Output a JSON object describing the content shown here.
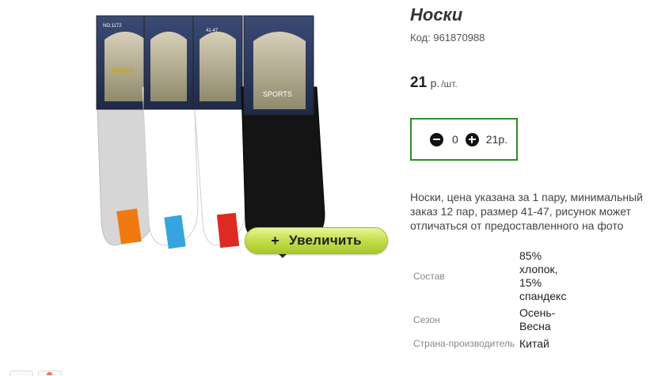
{
  "product": {
    "title": "Носки",
    "code_label": "Код:",
    "code_value": "961870988",
    "price_value": "21",
    "price_unit_main": "р.",
    "price_unit_sub": "/шт.",
    "quantity": "0",
    "total": "21р.",
    "description": "Носки, цена указана за 1 пару, минимальный заказ 12 пар, размер 41-47, рисунок может отличаться от предоставленного на фото",
    "zoom_label": "Увеличить",
    "zoom_plus": "+"
  },
  "image": {
    "package_labels": [
      "NO.1172",
      "41-47",
      "SPORTS",
      "AMISS"
    ],
    "sock_colors": [
      "#d6d6d6",
      "#ffffff",
      "#ffffff",
      "#141414"
    ],
    "heel_colors": [
      "#f07a10",
      "#36a5de",
      "#de2a22",
      "#141414"
    ]
  },
  "specs": [
    {
      "label": "Состав",
      "value": "85% хлопок, 15% спандекс"
    },
    {
      "label": "Сезон",
      "value": "Осень-Весна"
    },
    {
      "label": "Страна-производитель",
      "value": "Китай"
    }
  ],
  "icons": {
    "minus": "minus-circle-icon",
    "plus": "plus-circle-icon"
  },
  "colors": {
    "qty_border": "#2e8b2e",
    "zoom_button": "#c8e050"
  }
}
